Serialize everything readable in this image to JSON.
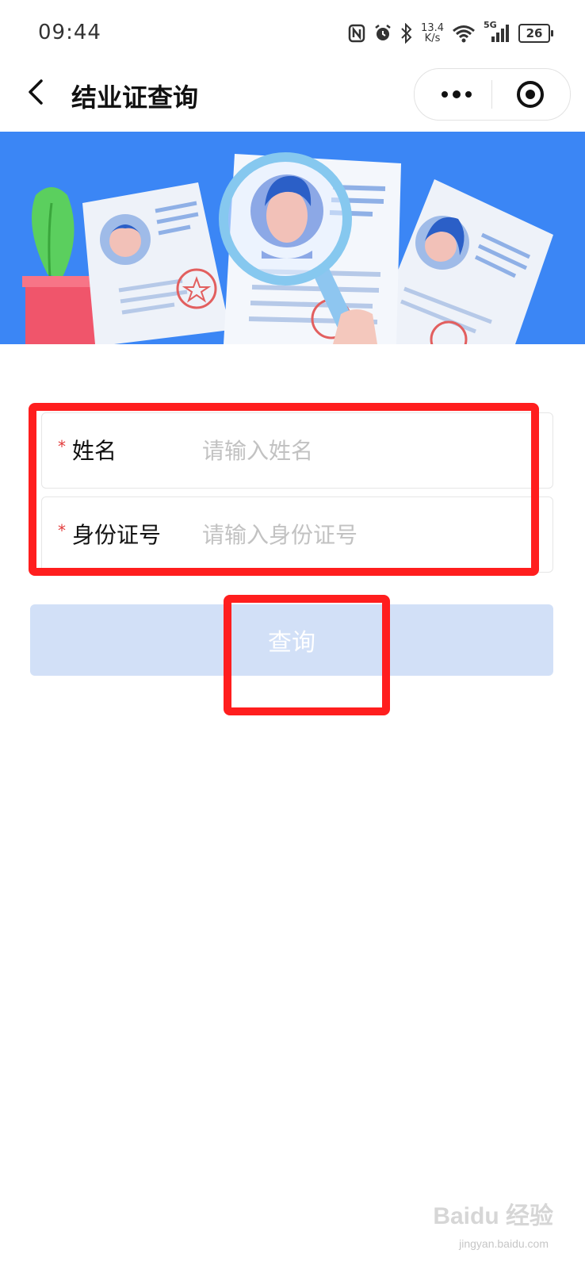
{
  "status_bar": {
    "time": "09:44",
    "speed_value": "13.4",
    "speed_unit": "K/s",
    "network": "5G",
    "battery": "26"
  },
  "nav": {
    "title": "结业证查询"
  },
  "form": {
    "name": {
      "required_mark": "*",
      "label": "姓名",
      "placeholder": "请输入姓名",
      "value": ""
    },
    "id_number": {
      "required_mark": "*",
      "label": "身份证号",
      "placeholder": "请输入身份证号",
      "value": ""
    }
  },
  "actions": {
    "query_label": "查询"
  },
  "watermark": {
    "brand": "Baidu 经验",
    "url": "jingyan.baidu.com"
  },
  "colors": {
    "banner_bg": "#3b86f5",
    "button_disabled": "#d2e0f7",
    "required": "#e23b3b",
    "annotation_red": "#ff1e1e"
  }
}
